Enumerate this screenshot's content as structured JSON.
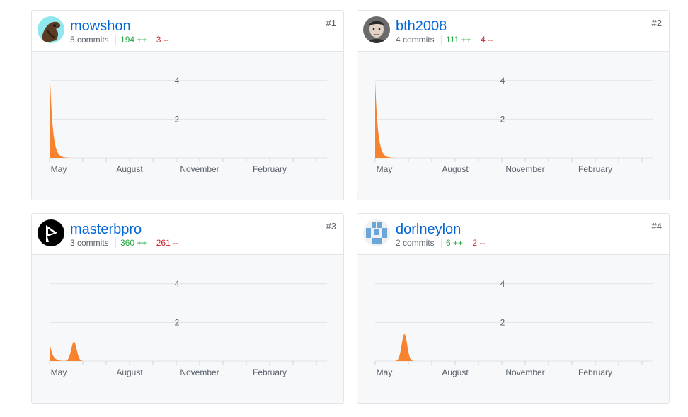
{
  "axis": {
    "x_ticks": [
      "May",
      "August",
      "November",
      "February"
    ],
    "y_ticks": [
      "4",
      "2"
    ]
  },
  "contributors": [
    {
      "rank": "#1",
      "username": "mowshon",
      "commits": "5 commits",
      "additions": "194 ++",
      "deletions": "3 --",
      "avatar_icon": "horse-avatar-icon",
      "chart_data": {
        "type": "area",
        "title": "",
        "ylim": [
          0,
          5
        ],
        "y_ticks": [
          2,
          4
        ],
        "x_ticks": [
          "May",
          "August",
          "November",
          "February"
        ],
        "weekly_commits": [
          5,
          0,
          0,
          0,
          0,
          0,
          0,
          0,
          0,
          0,
          0,
          0,
          0,
          0,
          0,
          0,
          0,
          0,
          0,
          0,
          0,
          0,
          0,
          0,
          0,
          0,
          0,
          0,
          0,
          0,
          0,
          0,
          0,
          0,
          0,
          0,
          0,
          0,
          0,
          0,
          0,
          0,
          0,
          0,
          0,
          0,
          0,
          0,
          0,
          0,
          0,
          0,
          0,
          0
        ]
      }
    },
    {
      "rank": "#2",
      "username": "bth2008",
      "commits": "4 commits",
      "additions": "111 ++",
      "deletions": "4 --",
      "avatar_icon": "person-photo-avatar-icon",
      "chart_data": {
        "type": "area",
        "title": "",
        "ylim": [
          0,
          5
        ],
        "y_ticks": [
          2,
          4
        ],
        "x_ticks": [
          "May",
          "August",
          "November",
          "February"
        ],
        "weekly_commits": [
          4,
          0,
          0,
          0,
          0,
          0,
          0,
          0,
          0,
          0,
          0,
          0,
          0,
          0,
          0,
          0,
          0,
          0,
          0,
          0,
          0,
          0,
          0,
          0,
          0,
          0,
          0,
          0,
          0,
          0,
          0,
          0,
          0,
          0,
          0,
          0,
          0,
          0,
          0,
          0,
          0,
          0,
          0,
          0,
          0,
          0,
          0,
          0,
          0,
          0,
          0,
          0,
          0,
          0
        ]
      }
    },
    {
      "rank": "#3",
      "username": "masterbpro",
      "commits": "3 commits",
      "additions": "360 ++",
      "deletions": "261 --",
      "avatar_icon": "play-logo-avatar-icon",
      "chart_data": {
        "type": "area",
        "title": "",
        "ylim": [
          0,
          5
        ],
        "y_ticks": [
          2,
          4
        ],
        "x_ticks": [
          "May",
          "August",
          "November",
          "February"
        ],
        "weekly_commits": [
          1,
          0,
          0,
          0,
          0,
          1,
          0,
          0,
          0,
          0,
          0,
          0,
          0,
          0,
          0,
          0,
          0,
          0,
          0,
          0,
          0,
          0,
          0,
          0,
          0,
          0,
          0,
          0,
          0,
          0,
          0,
          0,
          0,
          0,
          0,
          0,
          0,
          0,
          0,
          0,
          0,
          0,
          0,
          0,
          0,
          0,
          0,
          0,
          0,
          0,
          0,
          0,
          0,
          0
        ]
      }
    },
    {
      "rank": "#4",
      "username": "dorlneylon",
      "commits": "2 commits",
      "additions": "6 ++",
      "deletions": "2 --",
      "avatar_icon": "identicon-avatar-icon",
      "chart_data": {
        "type": "area",
        "title": "",
        "ylim": [
          0,
          5
        ],
        "y_ticks": [
          2,
          4
        ],
        "x_ticks": [
          "May",
          "August",
          "November",
          "February"
        ],
        "weekly_commits": [
          0,
          0,
          0,
          0,
          0,
          0,
          1.4,
          0,
          0,
          0,
          0,
          0,
          0,
          0,
          0,
          0,
          0,
          0,
          0,
          0,
          0,
          0,
          0,
          0,
          0,
          0,
          0,
          0,
          0,
          0,
          0,
          0,
          0,
          0,
          0,
          0,
          0,
          0,
          0,
          0,
          0,
          0,
          0,
          0,
          0,
          0,
          0,
          0,
          0,
          0,
          0,
          0,
          0,
          0
        ]
      }
    }
  ],
  "colors": {
    "area": "#f9822f",
    "link": "#0366d6",
    "additions": "#28a745",
    "deletions": "#cb2431"
  }
}
